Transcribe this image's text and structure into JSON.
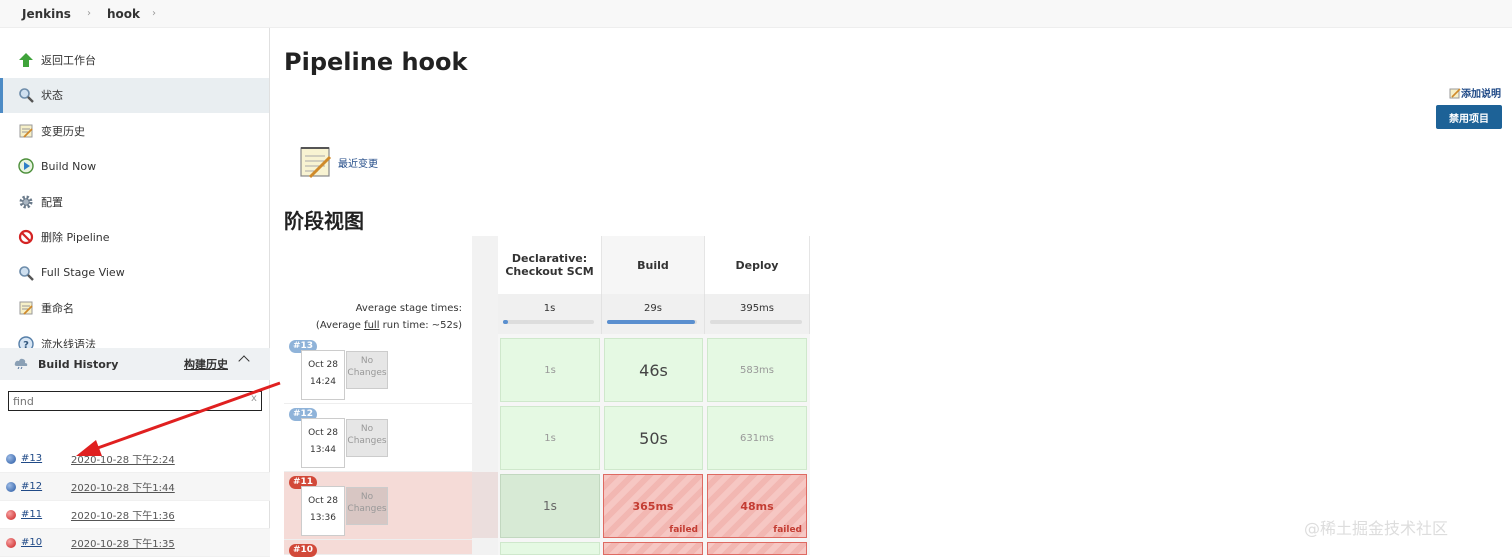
{
  "breadcrumb": {
    "root": "Jenkins",
    "job": "hook"
  },
  "sidebar": {
    "items": [
      {
        "label": "返回工作台",
        "icon": "up-arrow-icon"
      },
      {
        "label": "状态",
        "icon": "magnifier-icon"
      },
      {
        "label": "变更历史",
        "icon": "notepad-icon"
      },
      {
        "label": "Build Now",
        "icon": "build-now-icon"
      },
      {
        "label": "配置",
        "icon": "gear-icon"
      },
      {
        "label": "删除 Pipeline",
        "icon": "no-entry-icon"
      },
      {
        "label": "Full Stage View",
        "icon": "magnifier-icon"
      },
      {
        "label": "重命名",
        "icon": "notepad-icon"
      },
      {
        "label": "流水线语法",
        "icon": "help-icon"
      }
    ],
    "active_index": 1
  },
  "build_history": {
    "title": "Build History",
    "trend_link": "构建历史",
    "search_placeholder": "find",
    "search_clear": "x",
    "builds": [
      {
        "num": "#13",
        "date": "2020-10-28 下午2:24",
        "status": "success"
      },
      {
        "num": "#12",
        "date": "2020-10-28 下午1:44",
        "status": "success"
      },
      {
        "num": "#11",
        "date": "2020-10-28 下午1:36",
        "status": "failed"
      },
      {
        "num": "#10",
        "date": "2020-10-28 下午1:35",
        "status": "failed"
      }
    ]
  },
  "main": {
    "title": "Pipeline hook",
    "add_description": "添加说明",
    "disable_button": "禁用项目",
    "recent_changes": "最近变更",
    "stage_view_title": "阶段视图"
  },
  "stage_view": {
    "avg_label": "Average stage times:",
    "full_prefix": "(Average ",
    "full_link": "full",
    "full_suffix": " run time: ~52s)",
    "stages": [
      {
        "name": "Declarative: Checkout SCM",
        "avg": "1s",
        "avg_fill": 0.05
      },
      {
        "name": "Build",
        "avg": "29s",
        "avg_fill": 0.98
      },
      {
        "name": "Deploy",
        "avg": "395ms",
        "avg_fill": 0.0
      }
    ],
    "runs": [
      {
        "badge": "#13",
        "date": "Oct 28",
        "time": "14:24",
        "changes": "No Changes",
        "status": "success",
        "cells": [
          {
            "text": "1s",
            "status": "success"
          },
          {
            "text": "46s",
            "status": "success"
          },
          {
            "text": "583ms",
            "status": "success"
          }
        ]
      },
      {
        "badge": "#12",
        "date": "Oct 28",
        "time": "13:44",
        "changes": "No Changes",
        "status": "success",
        "cells": [
          {
            "text": "1s",
            "status": "success"
          },
          {
            "text": "50s",
            "status": "success"
          },
          {
            "text": "631ms",
            "status": "success"
          }
        ]
      },
      {
        "badge": "#11",
        "date": "Oct 28",
        "time": "13:36",
        "changes": "No Changes",
        "status": "failed",
        "cells": [
          {
            "text": "1s",
            "status": "success"
          },
          {
            "text": "365ms",
            "status": "failed",
            "tag": "failed"
          },
          {
            "text": "48ms",
            "status": "failed",
            "tag": "failed"
          }
        ]
      },
      {
        "badge": "#10",
        "status": "failed"
      }
    ]
  },
  "watermark": "@稀土掘金技术社区",
  "colors": {
    "accent": "#1d6297",
    "success": "#e5f9e3",
    "failed": "#f6c7c3",
    "annotation_arrow": "#e02020"
  }
}
